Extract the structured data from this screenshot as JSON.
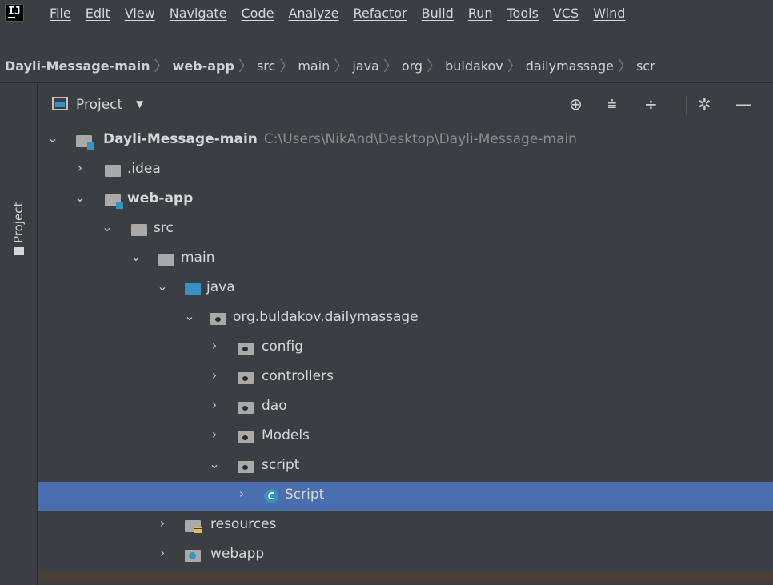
{
  "menubar": {
    "logo_text": "IJ",
    "items": [
      "File",
      "Edit",
      "View",
      "Navigate",
      "Code",
      "Analyze",
      "Refactor",
      "Build",
      "Run",
      "Tools",
      "VCS",
      "Wind"
    ]
  },
  "breadcrumbs": [
    "Dayli-Message-main",
    "web-app",
    "src",
    "main",
    "java",
    "org",
    "buldakov",
    "dailymassage",
    "scr"
  ],
  "side_stripe": {
    "label": "Project"
  },
  "panel": {
    "title": "Project",
    "icons": [
      "locate-icon",
      "expand-all-icon",
      "collapse-all-icon",
      "settings-icon",
      "hide-icon"
    ]
  },
  "tree": [
    {
      "label": "Dayli-Message-main",
      "path": "C:\\Users\\NikAnd\\Desktop\\Dayli-Message-main",
      "expanded": true,
      "icon": "module-folder-icon"
    },
    {
      "label": ".idea",
      "expanded": false,
      "icon": "folder-icon"
    },
    {
      "label": "web-app",
      "expanded": true,
      "icon": "module-folder-icon"
    },
    {
      "label": "src",
      "expanded": true,
      "icon": "folder-icon"
    },
    {
      "label": "main",
      "expanded": true,
      "icon": "folder-icon"
    },
    {
      "label": "java",
      "expanded": true,
      "icon": "source-folder-icon"
    },
    {
      "label": "org.buldakov.dailymassage",
      "expanded": true,
      "icon": "package-icon"
    },
    {
      "label": "config",
      "expanded": false,
      "icon": "package-icon"
    },
    {
      "label": "controllers",
      "expanded": false,
      "icon": "package-icon"
    },
    {
      "label": "dao",
      "expanded": false,
      "icon": "package-icon"
    },
    {
      "label": "Models",
      "expanded": false,
      "icon": "package-icon"
    },
    {
      "label": "script",
      "expanded": true,
      "icon": "package-icon"
    },
    {
      "label": "Script",
      "expanded": false,
      "icon": "class-icon",
      "class_letter": "C",
      "selected": true
    },
    {
      "label": "resources",
      "expanded": false,
      "icon": "resources-folder-icon"
    },
    {
      "label": "webapp",
      "expanded": false,
      "icon": "web-folder-icon"
    }
  ],
  "colors": {
    "background": "#3c3f41",
    "selection": "#4b6eaf",
    "text": "#d6d6d6",
    "accent_blue": "#3592c4"
  }
}
